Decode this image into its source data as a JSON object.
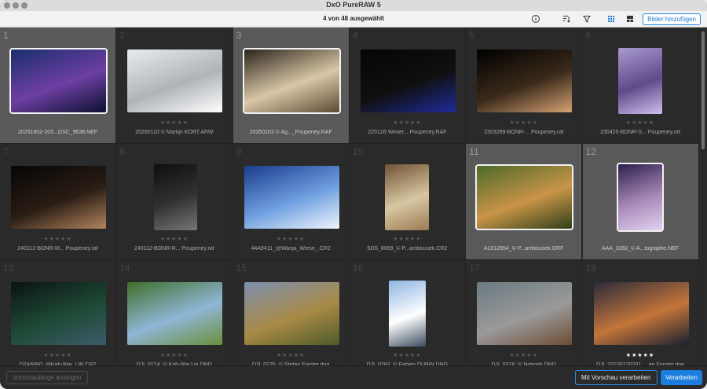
{
  "window": {
    "title": "DxO PureRAW 5"
  },
  "toolbar": {
    "status": "4 von 48 ausgewählt",
    "icons": [
      "info-icon",
      "sort-icon",
      "filter-icon",
      "grid-view-icon",
      "compare-view-icon"
    ],
    "add_label": "Bilder hinzufügen"
  },
  "grid": {
    "items": [
      {
        "num": "1",
        "stars": "★★★★★",
        "name": "20251802-203...DSC_9638.NEF",
        "selected": true,
        "rated": false,
        "c1": "#1b2e6e",
        "c2": "#6d3fa3",
        "c3": "#0c1030"
      },
      {
        "num": "2",
        "stars": "★★★★★",
        "name": "20260110 © Martijn KORT.ARW",
        "selected": false,
        "rated": false,
        "c1": "#e9ecee",
        "c2": "#aeb4b8",
        "c3": "#ffffff"
      },
      {
        "num": "3",
        "stars": "★★★★★",
        "name": "20350103 © Ag..._Poupeney.RAF",
        "selected": true,
        "rated": false,
        "c1": "#2b241c",
        "c2": "#d9c8a6",
        "c3": "#5b4a33"
      },
      {
        "num": "4",
        "stars": "★★★★★",
        "name": "220126-Winter... Poupeney.RAF",
        "selected": false,
        "rated": false,
        "c1": "#050505",
        "c2": "#101010",
        "c3": "#1e2b9c"
      },
      {
        "num": "5",
        "stars": "★★★★★",
        "name": "2303289-BONR-... Poupeney.raf",
        "selected": false,
        "rated": false,
        "c1": "#000000",
        "c2": "#3a2a1a",
        "c3": "#d7a274"
      },
      {
        "num": "6",
        "stars": "★★★★★",
        "name": "230425-BONR-S... Poupeney.raf",
        "selected": false,
        "rated": false,
        "c1": "#a99ad0",
        "c2": "#5e4b8a",
        "c3": "#cfc0ee"
      },
      {
        "num": "7",
        "stars": "★★★★★",
        "name": "240112-BONR-M... Poupeney.raf",
        "selected": false,
        "rated": false,
        "c1": "#060606",
        "c2": "#2a1d14",
        "c3": "#b5855d"
      },
      {
        "num": "8",
        "stars": "★★★★★",
        "name": "240112-BONR-R... Poupeney.raf",
        "selected": false,
        "rated": false,
        "c1": "#0e0e0e",
        "c2": "#333333",
        "c3": "#777777"
      },
      {
        "num": "9",
        "stars": "★★★★★",
        "name": "44A9411_@Wanja_Wiese_.CR2",
        "selected": false,
        "rated": false,
        "c1": "#1a3c8c",
        "c2": "#6fa0e0",
        "c3": "#f0f4fb"
      },
      {
        "num": "10",
        "stars": "★★★★★",
        "name": "5DS_8069_© P...ambousek.CR2",
        "selected": false,
        "rated": false,
        "c1": "#6f5233",
        "c2": "#d8c7a3",
        "c3": "#9b7b52"
      },
      {
        "num": "11",
        "stars": "★★★★★",
        "name": "A1012854_© P...ambousek.ORF",
        "selected": true,
        "rated": false,
        "c1": "#4d6a2a",
        "c2": "#c99447",
        "c3": "#2d3f17"
      },
      {
        "num": "12",
        "stars": "★★★★★",
        "name": "AAA_3392_© A...tographe.NEF",
        "selected": true,
        "rated": false,
        "c1": "#2d1f4f",
        "c2": "#a98ab8",
        "c3": "#e1d2ef"
      },
      {
        "num": "13",
        "stars": "★★★★★",
        "name": "D2A6860_@Kah-Wai_LIN.CR2",
        "selected": false,
        "rated": false,
        "c1": "#0b1410",
        "c2": "#1e4a36",
        "c3": "#3a5d6a"
      },
      {
        "num": "14",
        "stars": "★★★★★",
        "name": "DJI_0124_© Kah-Wai Lin.DNG",
        "selected": false,
        "rated": false,
        "c1": "#3e6f2a",
        "c2": "#8fb6d6",
        "c3": "#6a8f3a"
      },
      {
        "num": "15",
        "stars": "★★★★★",
        "name": "DJI_0276_© Stefan Forster.dng",
        "selected": false,
        "rated": false,
        "c1": "#7d8fb0",
        "c2": "#a88a45",
        "c3": "#4f5a2a"
      },
      {
        "num": "16",
        "stars": "★★★★★",
        "name": "DJI_0283_© Fabien DUBIN.DNG",
        "selected": false,
        "rated": false,
        "c1": "#8fb4e3",
        "c2": "#ffffff",
        "c3": "#3b4b5e"
      },
      {
        "num": "17",
        "stars": "★★★★★",
        "name": "DJI_0378_© Nobosh.DNG",
        "selected": false,
        "rated": false,
        "c1": "#6a7a80",
        "c2": "#9a9a9a",
        "c3": "#6e4c35"
      },
      {
        "num": "18",
        "stars": "★★★★★",
        "name": "DJI_20230720201_...an Forster.dng",
        "selected": false,
        "rated": true,
        "c1": "#2b2a3a",
        "c2": "#c4753a",
        "c3": "#1a2030"
      }
    ]
  },
  "bottombar": {
    "preview_list_label": "Vorschaulänge anzeigen",
    "preview_process_label": "Mit Vorschau verarbeiten",
    "process_label": "Verarbeiten"
  }
}
